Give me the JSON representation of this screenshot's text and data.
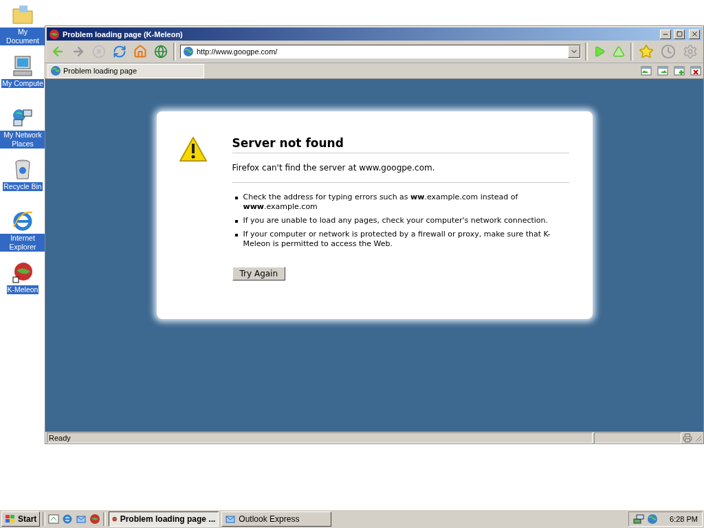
{
  "desktop_icons": [
    {
      "kind": "folder",
      "label": "My Document"
    },
    {
      "kind": "computer",
      "label": "My Compute"
    },
    {
      "kind": "network",
      "label": "My Network Places"
    },
    {
      "kind": "bin",
      "label": "Recycle Bin"
    },
    {
      "kind": "ie",
      "label": "Internet Explorer"
    },
    {
      "kind": "meleon",
      "label": "K-Meleon"
    }
  ],
  "window": {
    "title": "Problem loading page (K-Meleon)",
    "address": "http://www.googpe.com/",
    "tabs": [
      {
        "label": "Problem loading page",
        "selected": true
      }
    ],
    "status": "Ready"
  },
  "error_page": {
    "title": "Server not found",
    "message": "Firefox can't find the server at www.googpe.com.",
    "bullets": [
      "Check the address for typing errors such as **ww**.example.com instead of **www**.example.com",
      "If you are unable to load any pages, check your computer's network connection.",
      "If your computer or network is protected by a firewall or proxy, make sure that K-Meleon is permitted to access the Web."
    ],
    "button": "Try Again"
  },
  "taskbar": {
    "start": "Start",
    "tasks": [
      {
        "label": "Problem loading page ...",
        "selected": true
      },
      {
        "label": "Outlook Express",
        "selected": false
      }
    ],
    "clock": "6:28 PM"
  }
}
